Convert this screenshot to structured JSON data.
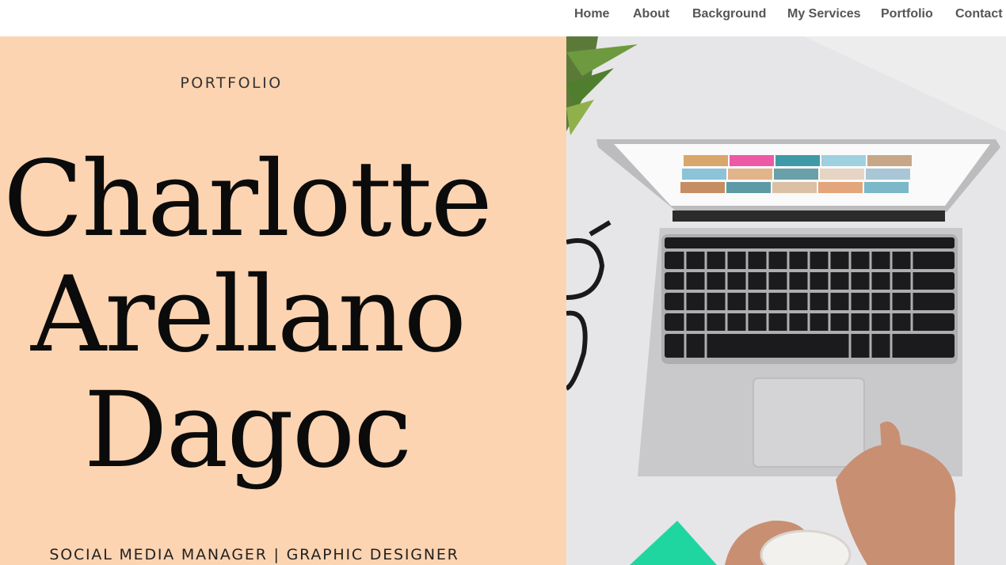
{
  "nav": {
    "items": [
      {
        "label": "Home"
      },
      {
        "label": "About"
      },
      {
        "label": "Background"
      },
      {
        "label": "My Services"
      },
      {
        "label": "Portfolio"
      },
      {
        "label": "Contact"
      }
    ]
  },
  "hero": {
    "eyebrow": "PORTFOLIO",
    "name_lines": [
      "Charlotte",
      "Arellano",
      "Dagoc"
    ],
    "subtitle": "SOCIAL MEDIA MANAGER  |  GRAPHIC DESIGNER"
  },
  "photo": {
    "description_icon": "laptop-desk-photo"
  },
  "colors": {
    "panel_bg": "#fdd4b1",
    "nav_text": "#555555",
    "accent_green": "#1fd6a0"
  }
}
